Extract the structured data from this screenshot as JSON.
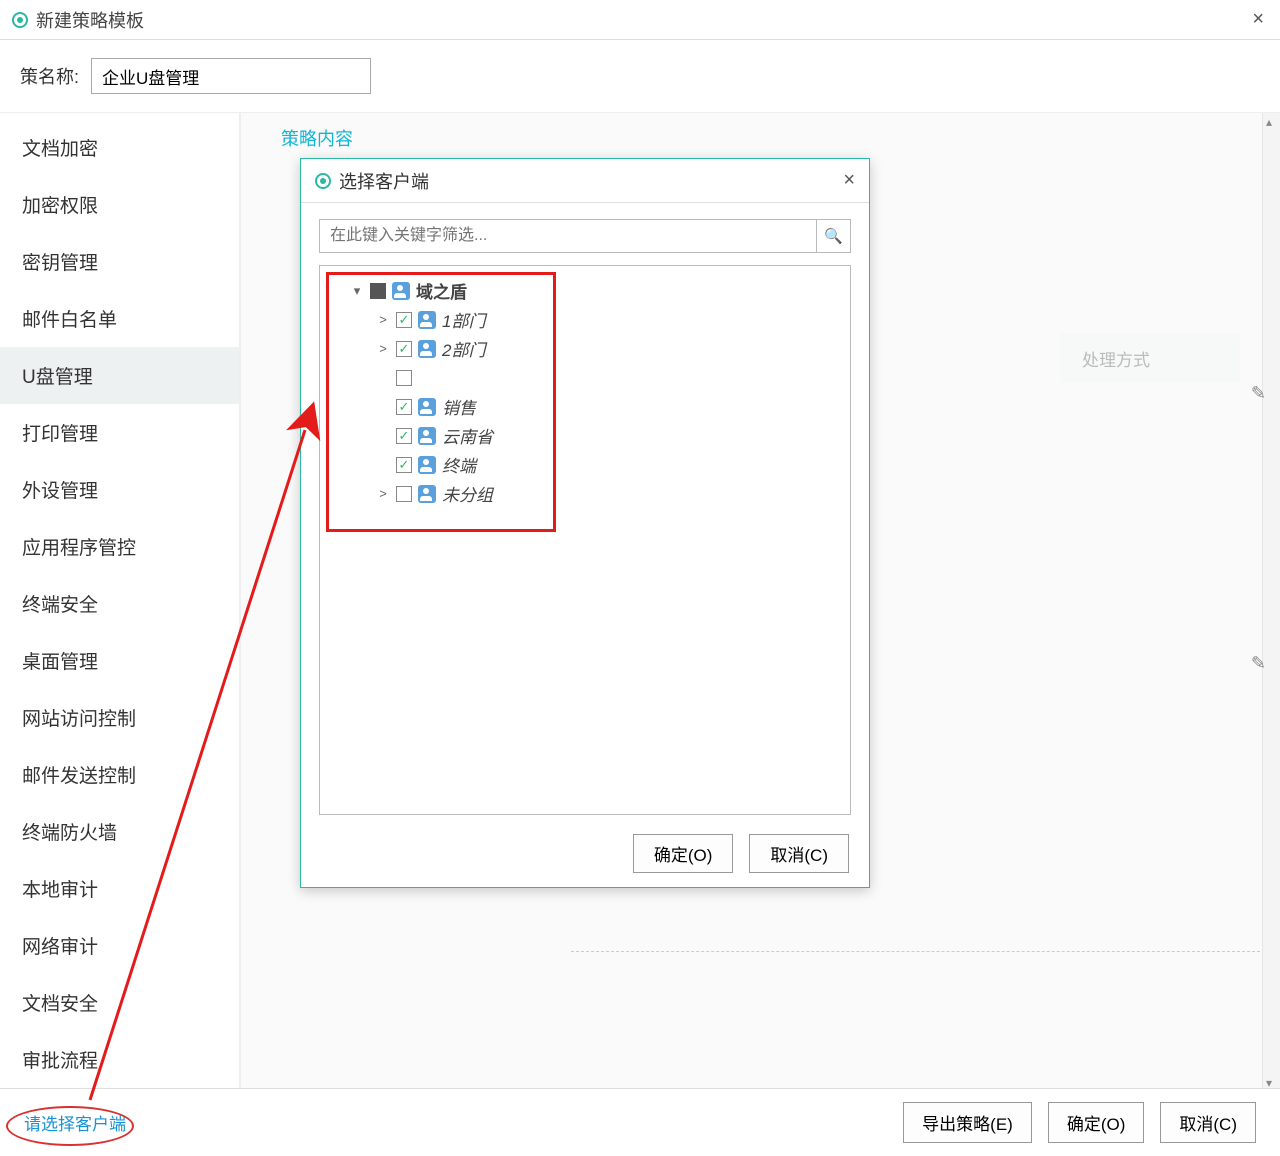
{
  "window": {
    "title": "新建策略模板"
  },
  "policy_name": {
    "label": "策名称:",
    "value": "企业U盘管理"
  },
  "sidebar": {
    "items": [
      "文档加密",
      "加密权限",
      "密钥管理",
      "邮件白名单",
      "U盘管理",
      "打印管理",
      "外设管理",
      "应用程序管控",
      "终端安全",
      "桌面管理",
      "网站访问控制",
      "邮件发送控制",
      "终端防火墙",
      "本地审计",
      "网络审计",
      "文档安全",
      "审批流程"
    ],
    "active_index": 4
  },
  "content": {
    "header": "策略内容",
    "process_label": "处理方式"
  },
  "footer": {
    "select_client": "请选择客户端",
    "export_btn": "导出策略(E)",
    "ok_btn": "确定(O)",
    "cancel_btn": "取消(C)"
  },
  "modal": {
    "title": "选择客户端",
    "search_placeholder": "在此键入关键字筛选...",
    "tree": {
      "root": "域之盾",
      "children": [
        {
          "label": "1部门",
          "check": "checked",
          "expand": ">"
        },
        {
          "label": "2部门",
          "check": "checked",
          "expand": ">"
        },
        {
          "label": "",
          "check": "unchecked",
          "expand": ""
        },
        {
          "label": "销售",
          "check": "checked",
          "expand": ""
        },
        {
          "label": "云南省",
          "check": "checked",
          "expand": ""
        },
        {
          "label": "终端",
          "check": "checked",
          "expand": ""
        },
        {
          "label": "未分组",
          "check": "unchecked",
          "expand": ">"
        }
      ]
    },
    "ok_btn": "确定(O)",
    "cancel_btn": "取消(C)"
  }
}
